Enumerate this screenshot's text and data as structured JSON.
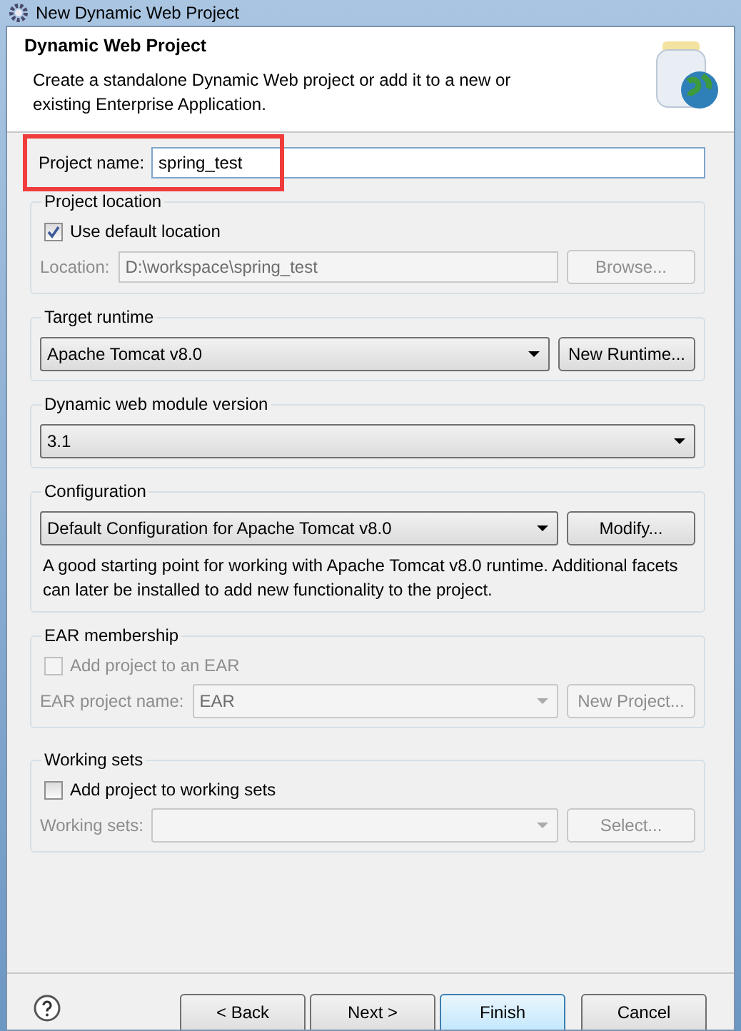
{
  "window": {
    "title": "New Dynamic Web Project"
  },
  "header": {
    "title": "Dynamic Web Project",
    "description": "Create a standalone Dynamic Web project or add it to a new or existing Enterprise Application."
  },
  "project_name": {
    "label": "Project name:",
    "value": "spring_test",
    "highlighted": true
  },
  "project_location": {
    "title": "Project location",
    "checkbox": {
      "label": "Use default location",
      "checked": true,
      "disabled": false
    },
    "field": {
      "label": "Location:",
      "value": "D:\\workspace\\spring_test",
      "disabled": true
    },
    "button": {
      "label": "Browse...",
      "disabled": true
    }
  },
  "target_runtime": {
    "title": "Target runtime",
    "value": "Apache Tomcat v8.0",
    "button": {
      "label": "New Runtime...",
      "disabled": false
    }
  },
  "module_version": {
    "title": "Dynamic web module version",
    "value": "3.1"
  },
  "configuration": {
    "title": "Configuration",
    "value": "Default Configuration for Apache Tomcat v8.0",
    "button": {
      "label": "Modify...",
      "disabled": false
    },
    "description": "A good starting point for working with Apache Tomcat v8.0 runtime. Additional facets can later be installed to add new functionality to the project."
  },
  "ear_membership": {
    "title": "EAR membership",
    "checkbox": {
      "label": "Add project to an EAR",
      "checked": false,
      "disabled": true
    },
    "field": {
      "label": "EAR project name:",
      "value": "EAR",
      "disabled": true
    },
    "button": {
      "label": "New Project...",
      "disabled": true
    }
  },
  "working_sets": {
    "title": "Working sets",
    "checkbox": {
      "label": "Add project to working sets",
      "checked": false,
      "disabled": false
    },
    "field": {
      "label": "Working sets:",
      "disabled": true
    },
    "button": {
      "label": "Select...",
      "disabled": true
    }
  },
  "buttons": [
    {
      "label": "< Back",
      "default": false
    },
    {
      "label": "Next >",
      "default": false
    },
    {
      "label": "Finish",
      "default": true
    },
    {
      "label": "Cancel",
      "default": false
    }
  ]
}
